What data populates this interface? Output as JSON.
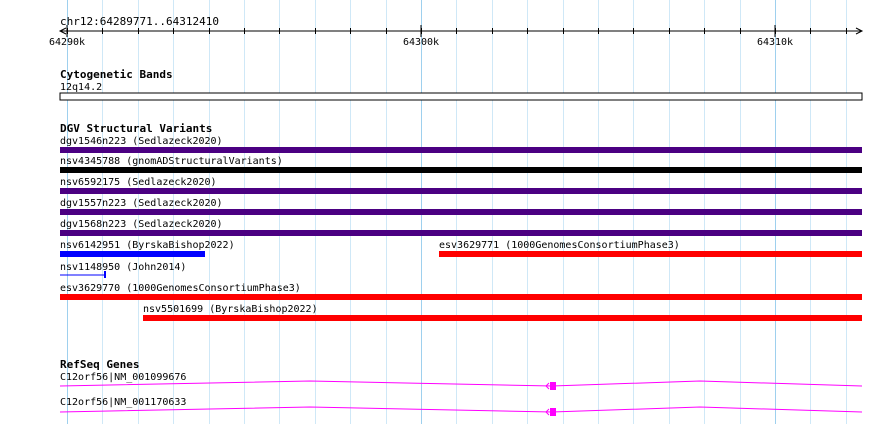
{
  "ruler": {
    "location": "chr12:64289771..64312410",
    "ticks": [
      "64290k",
      "64300k",
      "64310k"
    ]
  },
  "tracks": {
    "cytoband": {
      "title": "Cytogenetic Bands",
      "band": "12q14.2"
    },
    "dgv": {
      "title": "DGV Structural Variants",
      "colors": {
        "purple": "#4b0082",
        "black": "#000000",
        "blue": "#0000ff",
        "red": "#ff0000"
      },
      "features": [
        {
          "label": "dgv1546n223 (Sedlazeck2020)",
          "color": "purple"
        },
        {
          "label": "nsv4345788 (gnomADStructuralVariants)",
          "color": "black"
        },
        {
          "label": "nsv6592175 (Sedlazeck2020)",
          "color": "purple"
        },
        {
          "label": "dgv1557n223 (Sedlazeck2020)",
          "color": "purple"
        },
        {
          "label": "dgv1568n223 (Sedlazeck2020)",
          "color": "purple"
        },
        {
          "label": "nsv6142951 (ByrskaBishop2022)",
          "color": "blue"
        },
        {
          "label": "esv3629771 (1000GenomesConsortiumPhase3)",
          "color": "red"
        },
        {
          "label": "nsv1148950 (John2014)",
          "color": "blue"
        },
        {
          "label": "esv3629770 (1000GenomesConsortiumPhase3)",
          "color": "red"
        },
        {
          "label": "nsv5501699 (ByrskaBishop2022)",
          "color": "red"
        }
      ]
    },
    "refseq": {
      "title": "RefSeq Genes",
      "color": "#ff00ff",
      "genes": [
        {
          "label": "C12orf56|NM_001099676"
        },
        {
          "label": "C12orf56|NM_001170633"
        }
      ]
    }
  }
}
